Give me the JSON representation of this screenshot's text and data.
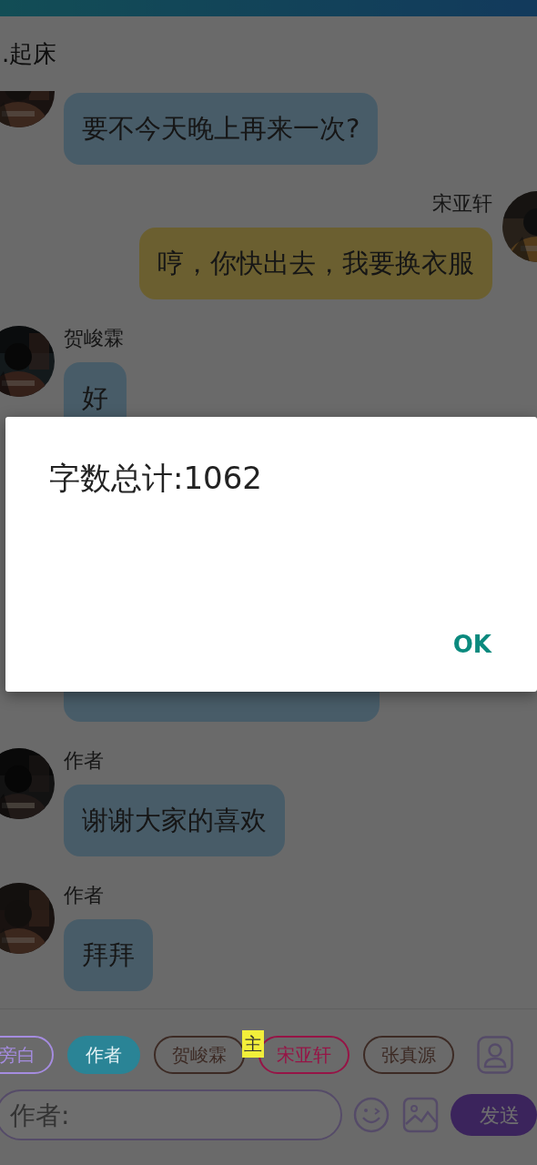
{
  "header": {
    "title": ".起床"
  },
  "messages": [
    {
      "kind": "incoming",
      "text": "要不今天晚上再来一次?"
    },
    {
      "kind": "outgoing",
      "name": "宋亚轩",
      "text": "哼，你快出去，我要换衣服"
    },
    {
      "kind": "incoming",
      "name": "贺峻霖",
      "text": "好"
    },
    {
      "kind": "covered"
    },
    {
      "kind": "incoming",
      "name": "作者",
      "text": "谢谢大家的喜欢"
    },
    {
      "kind": "incoming",
      "name": "作者",
      "text": "拜拜"
    }
  ],
  "roles": [
    {
      "label": "旁白",
      "color": "#a58ce0",
      "selected": false
    },
    {
      "label": "作者",
      "color": "#2a8496",
      "selected": true
    },
    {
      "label": "贺峻霖",
      "color": "#3c2a24",
      "selected": false
    },
    {
      "label": "宋亚轩",
      "color": "#961446",
      "selected": false,
      "badge": "主"
    },
    {
      "label": "张真源",
      "color": "#3c2a24",
      "selected": false
    }
  ],
  "composer": {
    "placeholder": "作者:",
    "send": "发送"
  },
  "dialog": {
    "message": "字数总计:1062",
    "button": "OK"
  }
}
